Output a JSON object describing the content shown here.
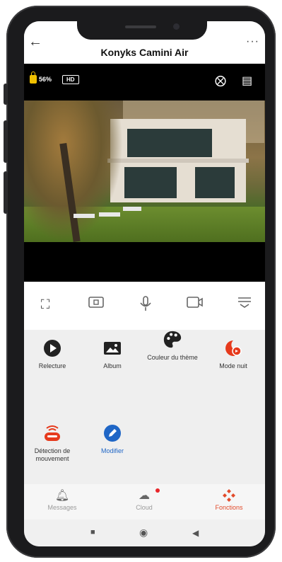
{
  "header": {
    "back_icon": "arrow-left-icon",
    "title": "Konyks Camini Air",
    "more_icon": "ellipsis-icon"
  },
  "camera_status": {
    "battery": "56%",
    "quality": "HD"
  },
  "tools": [
    "fullscreen-icon",
    "snapshot-icon",
    "microphone-icon",
    "record-icon",
    "menu-icon"
  ],
  "features": [
    {
      "label": "Relecture"
    },
    {
      "label": "Album"
    },
    {
      "label": "Couleur du thème"
    },
    {
      "label": "Mode nuit"
    },
    {
      "label": "Détection de mouvement"
    },
    {
      "label": "Modifier"
    }
  ],
  "tabs": [
    {
      "label": "Messages"
    },
    {
      "label": "Cloud"
    },
    {
      "label": "Fonctions"
    }
  ],
  "colors": {
    "accent": "#e24a2a",
    "modifier_blue": "#1f66c6",
    "dark": "#1b1b1d"
  }
}
